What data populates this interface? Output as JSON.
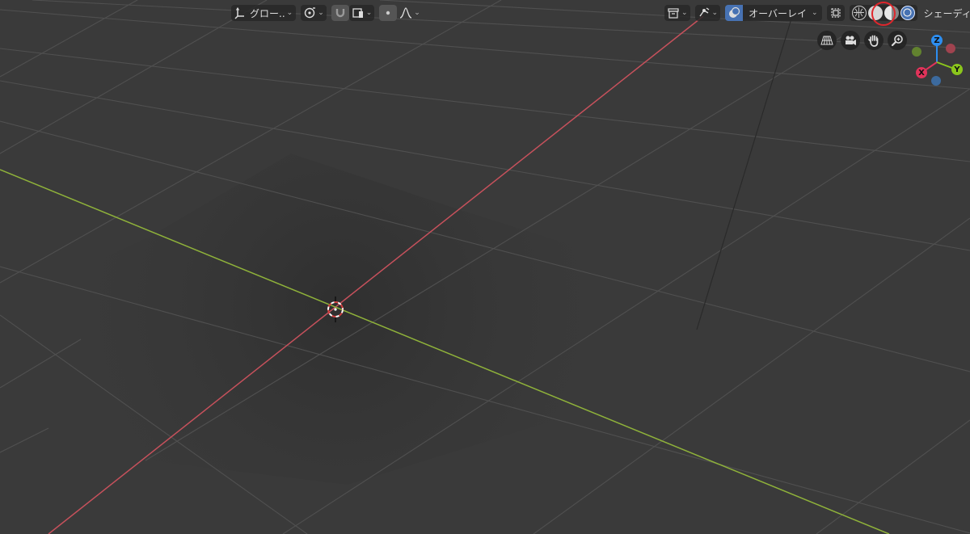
{
  "header_left": {
    "transform_orientation": "グロー..",
    "transform_orientation_icon": "orientation-axes-icon",
    "pivot_icon": "pivot-point-icon",
    "snap_icon": "snap-magnet-icon",
    "snap_target_icon": "snap-target-icon",
    "proportional_icon": "proportional-edit-icon",
    "falloff_icon": "falloff-curve-icon"
  },
  "header_right": {
    "object_types_icon": "object-types-icon",
    "gizmo_toggle_icon": "gizmo-icon",
    "overlay_toggle_icon": "overlay-icon",
    "overlay_label": "オーバーレイ",
    "xray_icon": "xray-icon",
    "shading_modes": [
      "wireframe",
      "solid",
      "material-preview",
      "rendered"
    ],
    "active_shading": "rendered",
    "shading_label": "シェーディング"
  },
  "nav_controls": {
    "buttons": [
      "perspective-grid-icon",
      "camera-icon",
      "hand-pan-icon",
      "zoom-icon"
    ]
  },
  "axis_gizmo": {
    "z_label": "Z",
    "x_label": "X",
    "y_label": "Y",
    "colors": {
      "x": "#e0335a",
      "y": "#8bc61c",
      "z": "#2d8ef0",
      "neg_x": "#a0434f",
      "neg_y": "#62822f",
      "neg_z": "#3c6a9e"
    }
  },
  "colors": {
    "background": "#3a3a3a",
    "grid_line": "#505050",
    "x_axis": "#c7515c",
    "y_axis": "#8fb23a",
    "highlight_circle": "#e0262c",
    "active_shading": "#4772b3"
  }
}
